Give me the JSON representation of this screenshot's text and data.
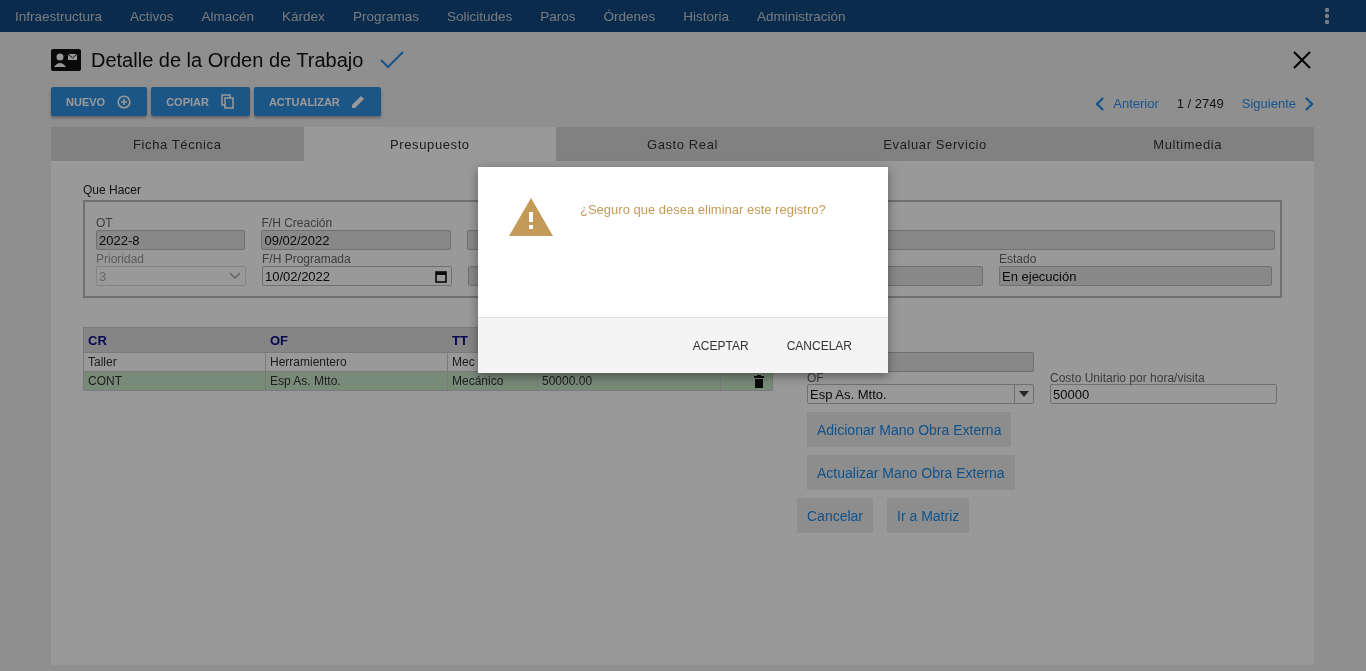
{
  "nav": {
    "items": [
      "Infraestructura",
      "Activos",
      "Almacén",
      "Kárdex",
      "Programas",
      "Solicitudes",
      "Paros",
      "Órdenes",
      "Historia",
      "Administración"
    ]
  },
  "header": {
    "title": "Detalle de la Orden de Trabajo",
    "saved": true,
    "buttons": [
      {
        "label": "NUEVO",
        "kind": "add"
      },
      {
        "label": "COPIAR",
        "kind": "copy"
      },
      {
        "label": "ACTUALIZAR",
        "kind": "edit"
      }
    ]
  },
  "pagination": {
    "previous": "Anterior",
    "position": "1 / 2749",
    "next": "Siguiente"
  },
  "tabs": [
    {
      "label": "Ficha Técnica",
      "selected": false
    },
    {
      "label": "Presupuesto",
      "selected": true
    },
    {
      "label": "Gasto Real",
      "selected": false
    },
    {
      "label": "Evaluar Servicio",
      "selected": false
    },
    {
      "label": "Multimedia",
      "selected": false
    }
  ],
  "form": {
    "section_label": "Que Hacer",
    "rows": [
      [
        {
          "label": "OT",
          "value": "2022-8",
          "kind": "text",
          "readonly": true
        },
        {
          "label": "F/H Creación",
          "value": "09/02/2022",
          "kind": "text",
          "readonly": true
        },
        {
          "kind": "text",
          "readonly": true
        },
        {
          "kind": "text",
          "readonly": true
        }
      ],
      [
        {
          "label": "Prioridad",
          "value": "3",
          "kind": "select",
          "disabled": true
        },
        {
          "label": "F/H Programada",
          "value": "10/02/2022",
          "kind": "date",
          "readonly": false
        },
        {
          "kind": "text",
          "readonly": true
        },
        {
          "label": "Estado",
          "value": "En ejecución",
          "kind": "text",
          "readonly": true
        }
      ]
    ]
  },
  "table": {
    "columns": [
      "CR",
      "OF",
      "TT"
    ],
    "rows": [
      {
        "cells": [
          "Taller",
          "Herramientero",
          "Mec"
        ],
        "selected": false
      },
      {
        "cells": [
          "CONT",
          "Esp As. Mtto.",
          "Mecánico",
          "50000.00"
        ],
        "selected": true
      }
    ]
  },
  "side_form": {
    "fields": [
      {
        "kind": "text",
        "readonly": true
      },
      {
        "label": "OF",
        "value": "Esp As. Mtto.",
        "kind": "combo",
        "readonly": false
      },
      {
        "label": "Costo Unitario por hora/visita",
        "value": "50000",
        "kind": "text",
        "readonly": false
      }
    ],
    "actions": [
      "Adicionar Mano Obra Externa",
      "Actualizar Mano Obra Externa"
    ],
    "footer_buttons": [
      "Cancelar",
      "Ir a Matriz"
    ]
  },
  "dialog": {
    "kind": "warning",
    "message": "¿Seguro que desea eliminar este registro?",
    "buttons": [
      "ACEPTAR",
      "CANCELAR"
    ]
  }
}
